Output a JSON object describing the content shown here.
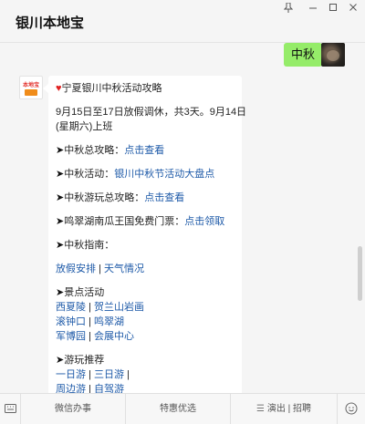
{
  "window": {
    "title": "银川本地宝",
    "pin_icon": "pin-icon",
    "minimize_icon": "minimize-icon",
    "maximize_icon": "maximize-icon",
    "close_icon": "close-icon"
  },
  "chat": {
    "my_message": "中秋",
    "bot_avatar_top": "本地宝",
    "bot_avatar_bottom": "银川",
    "article": {
      "title": "宁夏银川中秋活动攻略",
      "intro_line1": "9月15日至17日放假调休，共3天。9月14日",
      "intro_line2": "(星期六)上班",
      "item1_label": "中秋总攻略：",
      "item1_link": "点击查看",
      "item2_label": "中秋活动：",
      "item2_link": "银川中秋节活动大盘点",
      "item3_label": "中秋游玩总攻略：",
      "item3_link": "点击查看",
      "item4_label": "鸣翠湖南瓜王国免费门票：",
      "item4_link": "点击领取",
      "guide_label": "中秋指南：",
      "guide_link1": "放假安排",
      "guide_sep": " | ",
      "guide_link2": "天气情况",
      "spots_label": "景点活动",
      "spot1": "西夏陵",
      "spot2": "贺兰山岩画",
      "spot3": "滚钟口",
      "spot4": "鸣翠湖",
      "spot5": "军博园",
      "spot6": "会展中心",
      "tour_label": "游玩推荐",
      "tour1": "一日游",
      "tour2": "三日游",
      "tour3": "周边游",
      "tour4": "自驾游",
      "pipe": "|"
    }
  },
  "bottom_menu": {
    "keyboard_icon": "keyboard-icon",
    "item1": "微信办事",
    "item2": "特惠优选",
    "item3": "演出 | 招聘",
    "menu_icon": "hamburger-icon",
    "face_icon": "emoji-icon"
  }
}
